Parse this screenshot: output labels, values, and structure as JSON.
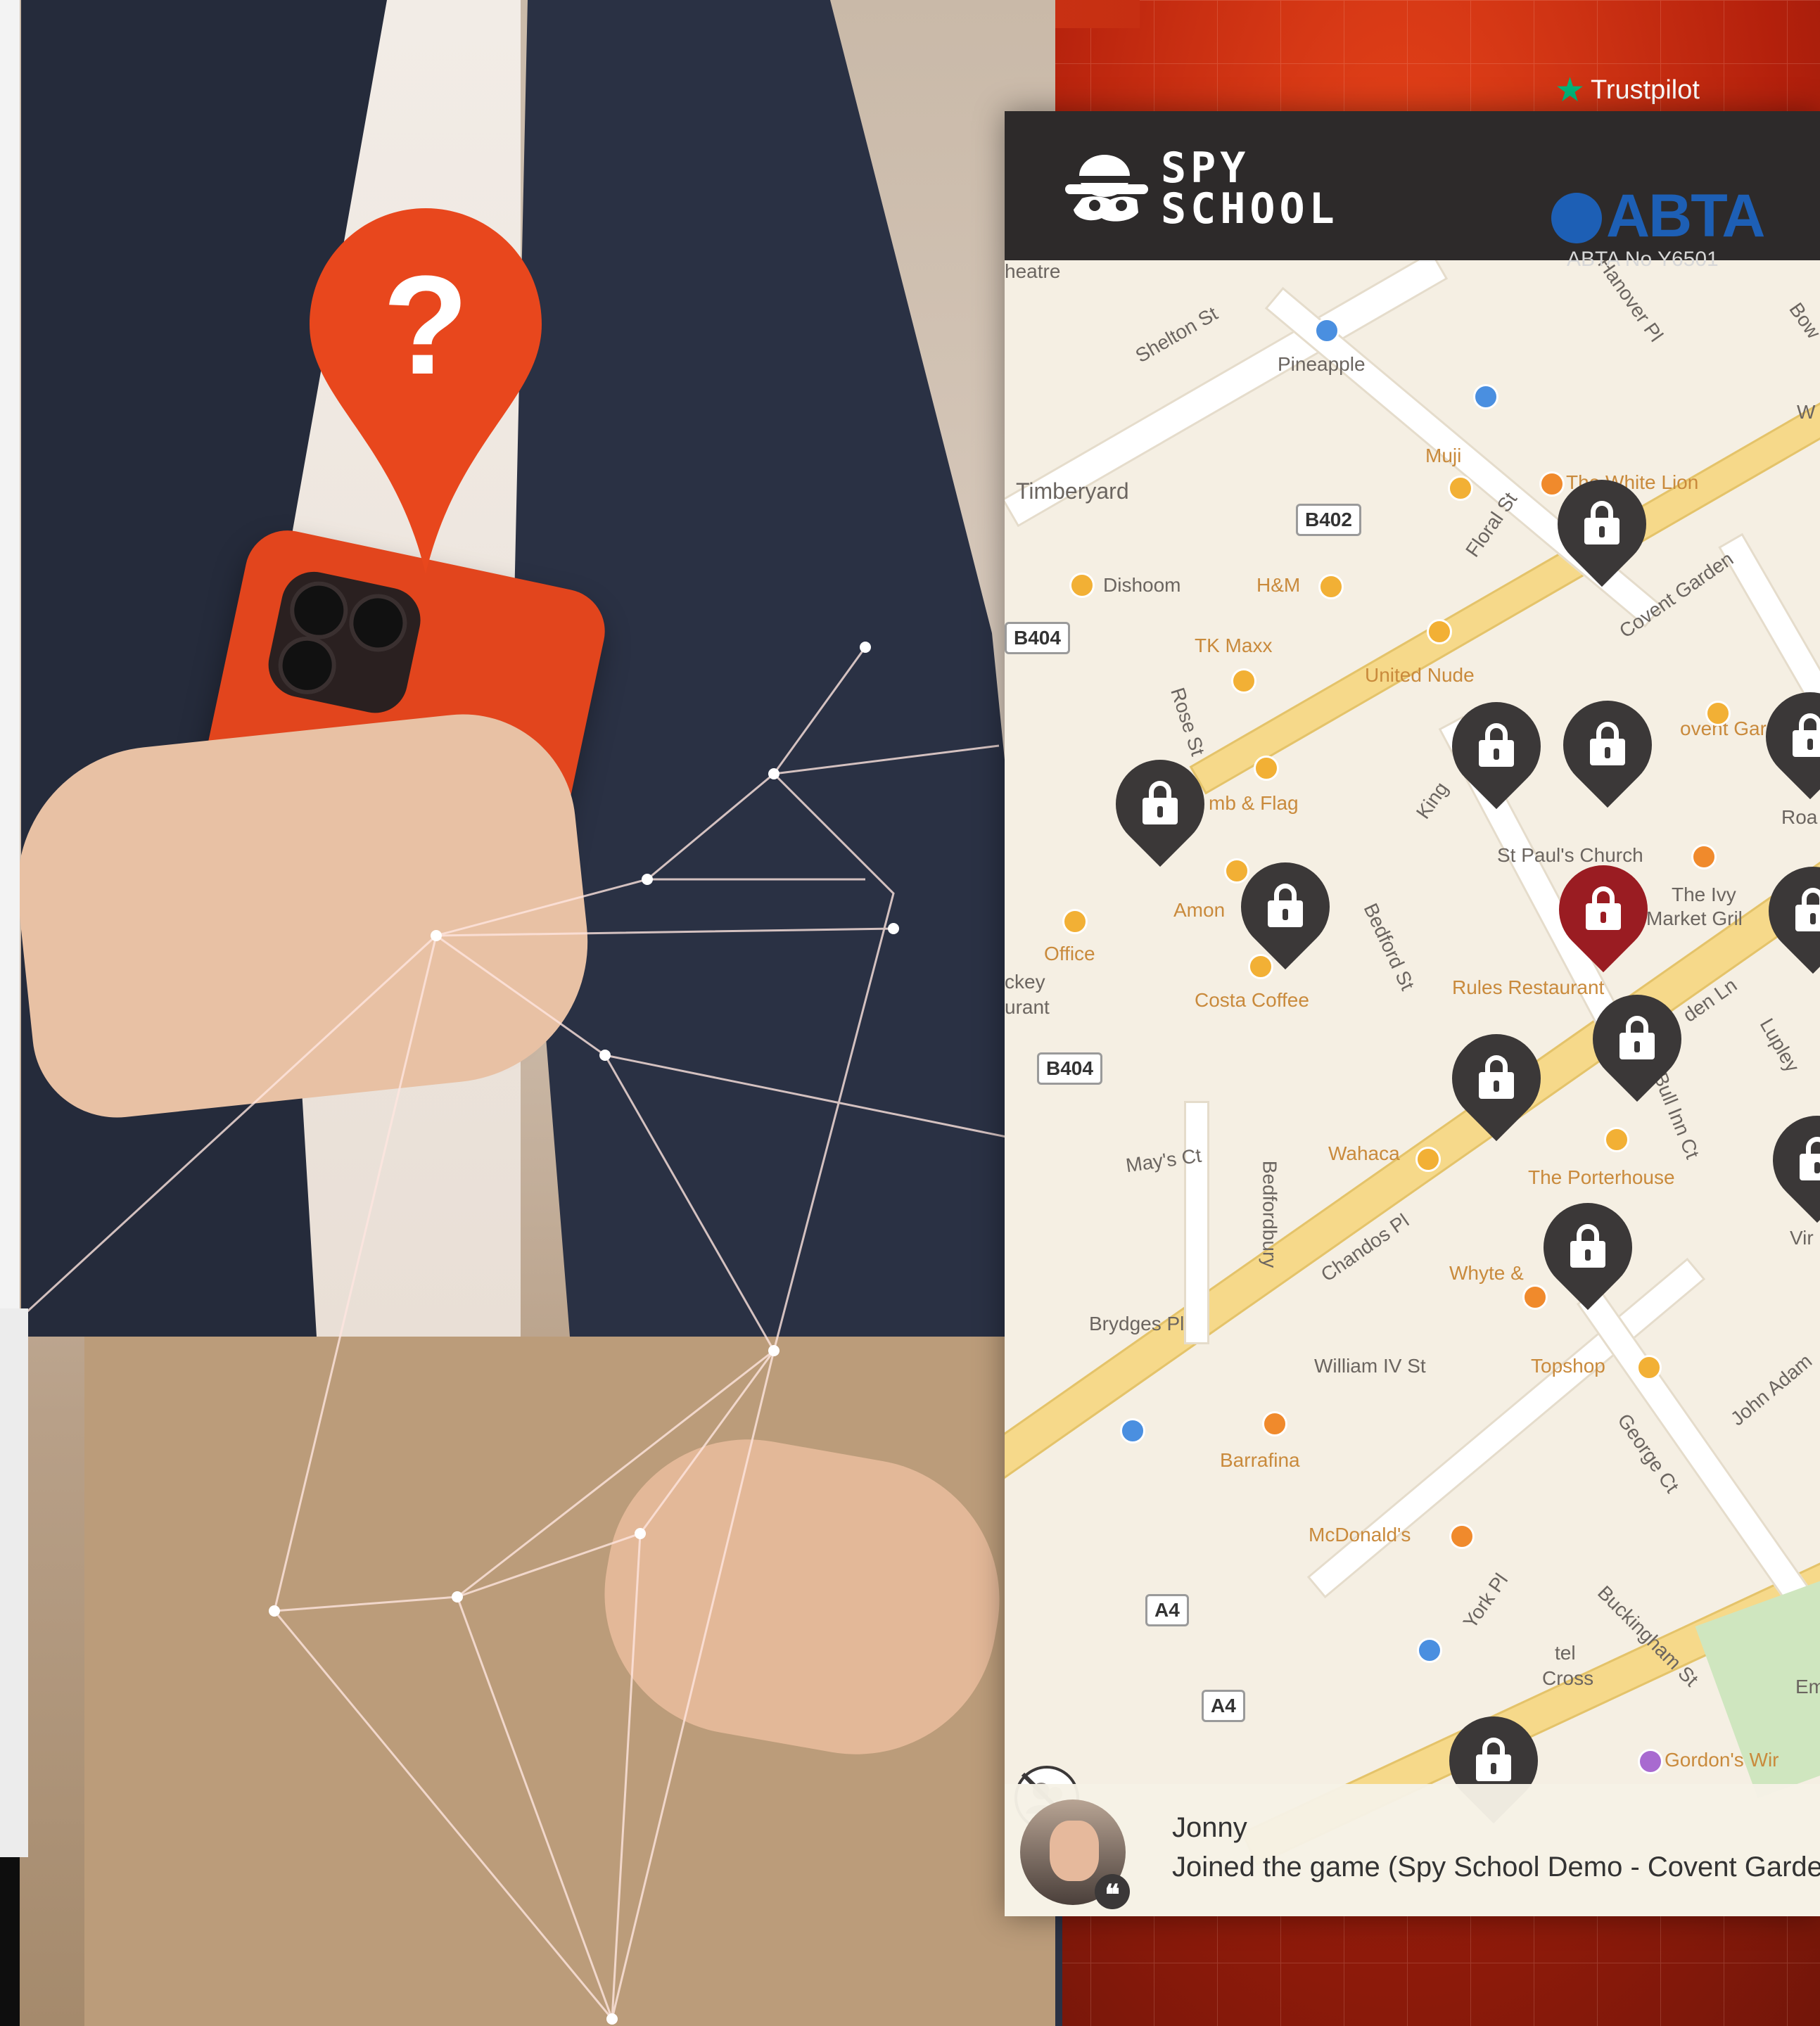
{
  "brand": {
    "name_line1": "SPY",
    "name_line2": "SCHOOL"
  },
  "trustpilot": {
    "label": "Trustpilot",
    "stars": 4.5,
    "color": "#00b67a"
  },
  "abta": {
    "name": "ABTA",
    "number": "ABTA No Y6501",
    "color": "#1d5fb5"
  },
  "map": {
    "labels": [
      {
        "text": "heatre",
        "tone": "grey"
      },
      {
        "text": "Shelton St",
        "tone": "grey"
      },
      {
        "text": "Pineapple",
        "tone": "grey"
      },
      {
        "text": "Hanover Pl",
        "tone": "grey"
      },
      {
        "text": "Bow",
        "tone": "grey"
      },
      {
        "text": "W",
        "tone": "grey"
      },
      {
        "text": "Timberyard",
        "tone": "grey"
      },
      {
        "text": "Muji",
        "tone": "orange"
      },
      {
        "text": "The White Lion",
        "tone": "orange"
      },
      {
        "text": "Floral St",
        "tone": "grey"
      },
      {
        "text": "Dishoom",
        "tone": "grey"
      },
      {
        "text": "H&M",
        "tone": "orange"
      },
      {
        "text": "Covent Garden",
        "tone": "grey"
      },
      {
        "text": "TK Maxx",
        "tone": "orange"
      },
      {
        "text": "United Nude",
        "tone": "orange"
      },
      {
        "text": "Rose St",
        "tone": "grey"
      },
      {
        "text": "ovent Gar",
        "tone": "orange"
      },
      {
        "text": "mb & Flag",
        "tone": "orange"
      },
      {
        "text": "King",
        "tone": "grey"
      },
      {
        "text": "Roa",
        "tone": "grey"
      },
      {
        "text": "St Paul's Church",
        "tone": "grey"
      },
      {
        "text": "The Ivy",
        "tone": "grey"
      },
      {
        "text": "Market Gril",
        "tone": "grey"
      },
      {
        "text": "Amon",
        "tone": "orange"
      },
      {
        "text": "Office",
        "tone": "orange"
      },
      {
        "text": "Bedford St",
        "tone": "grey"
      },
      {
        "text": "Rules Restaurant",
        "tone": "orange"
      },
      {
        "text": "den Ln",
        "tone": "grey"
      },
      {
        "text": "Lupley",
        "tone": "grey"
      },
      {
        "text": "ckey",
        "tone": "grey"
      },
      {
        "text": "urant",
        "tone": "grey"
      },
      {
        "text": "Costa Coffee",
        "tone": "orange"
      },
      {
        "text": "Bull Inn Ct",
        "tone": "grey"
      },
      {
        "text": "May's Ct",
        "tone": "grey"
      },
      {
        "text": "Bedfordbury",
        "tone": "grey"
      },
      {
        "text": "Wahaca",
        "tone": "orange"
      },
      {
        "text": "The Porterhouse",
        "tone": "orange"
      },
      {
        "text": "Chandos Pl",
        "tone": "grey"
      },
      {
        "text": "Vir",
        "tone": "grey"
      },
      {
        "text": "Whyte &",
        "tone": "orange"
      },
      {
        "text": "Brydges Pl",
        "tone": "grey"
      },
      {
        "text": "William IV St",
        "tone": "grey"
      },
      {
        "text": "Topshop",
        "tone": "orange"
      },
      {
        "text": "George Ct",
        "tone": "grey"
      },
      {
        "text": "John Adam",
        "tone": "grey"
      },
      {
        "text": "Barrafina",
        "tone": "orange"
      },
      {
        "text": "McDonald's",
        "tone": "orange"
      },
      {
        "text": "York Pl",
        "tone": "grey"
      },
      {
        "text": "Buckingham St",
        "tone": "grey"
      },
      {
        "text": "tel",
        "tone": "grey"
      },
      {
        "text": "Cross",
        "tone": "grey"
      },
      {
        "text": "Em",
        "tone": "grey"
      },
      {
        "text": "Gordon's Wir",
        "tone": "orange"
      }
    ],
    "shields": [
      "B402",
      "B404",
      "B404",
      "A4",
      "A4"
    ],
    "pins": [
      {
        "state": "locked"
      },
      {
        "state": "locked"
      },
      {
        "state": "locked"
      },
      {
        "state": "locked"
      },
      {
        "state": "locked"
      },
      {
        "state": "active"
      },
      {
        "state": "locked"
      },
      {
        "state": "locked"
      },
      {
        "state": "locked"
      },
      {
        "state": "locked"
      },
      {
        "state": "locked"
      },
      {
        "state": "locked"
      },
      {
        "state": "locked"
      }
    ]
  },
  "notification": {
    "name": "Jonny",
    "text": "Joined the game (Spy School Demo - Covent Garde"
  },
  "colors": {
    "accent_orange": "#e2451d",
    "pin_dark": "#3b3838",
    "pin_red": "#9a1c22",
    "header_dark": "#2d2a2a"
  }
}
